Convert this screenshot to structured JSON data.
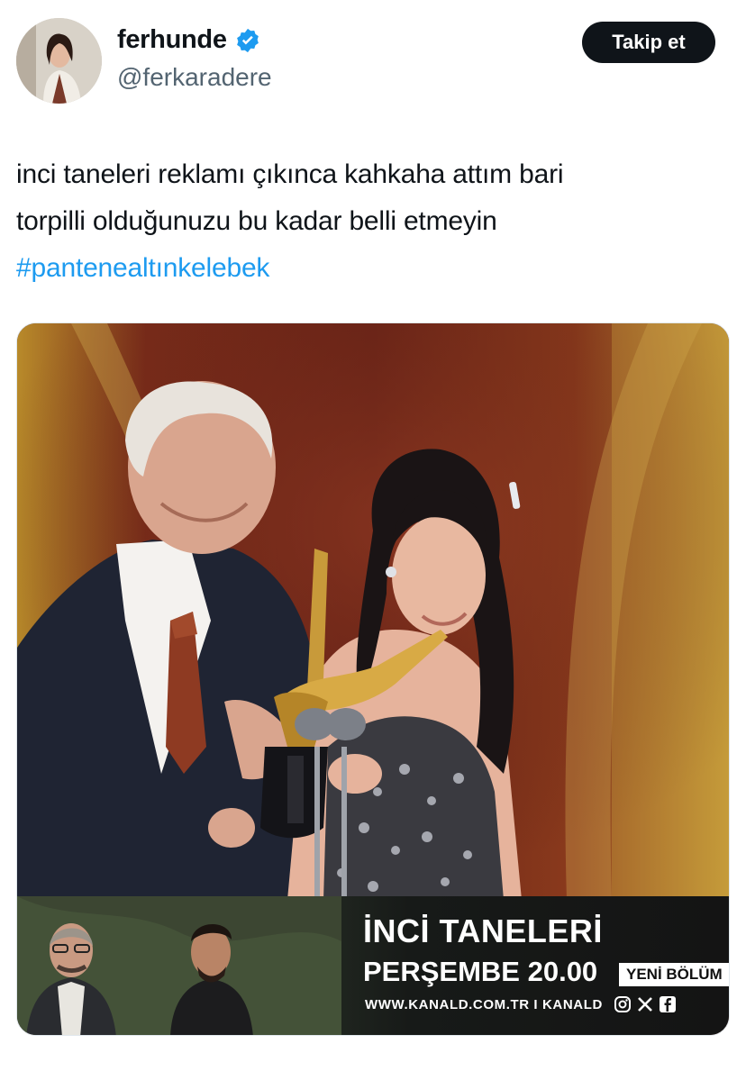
{
  "author": {
    "display_name": "ferhunde",
    "handle": "@ferkaradere",
    "verified": true,
    "avatar_icon": "profile-photo"
  },
  "actions": {
    "follow_label": "Takip et"
  },
  "tweet": {
    "line1": "inci taneleri reklamı çıkınca kahkaha attım bari",
    "line2": "torpilli olduğunuzu bu kadar belli etmeyin",
    "hashtag": "#pantenealtınkelebek"
  },
  "media": {
    "ad_banner": {
      "title": "İNCİ TANELERİ",
      "schedule": "PERŞEMBE 20.00",
      "badge": "YENİ BÖLÜM",
      "url": "WWW.KANALD.COM.TR I KANALD",
      "social_icons": [
        "instagram-icon",
        "x-icon",
        "facebook-icon"
      ]
    }
  },
  "colors": {
    "link": "#1d9bf0",
    "verified": "#1d9bf0",
    "follow_bg": "#0f1419",
    "handle": "#536471"
  }
}
